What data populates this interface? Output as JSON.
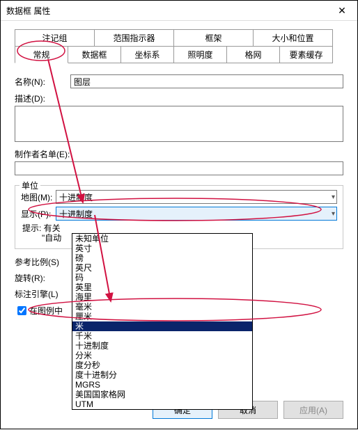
{
  "window": {
    "title": "数据框 属性"
  },
  "tabs": {
    "top": [
      {
        "label": "注记组"
      },
      {
        "label": "范围指示器"
      },
      {
        "label": "框架"
      },
      {
        "label": "大小和位置"
      }
    ],
    "bottom": [
      {
        "label": "常规"
      },
      {
        "label": "数据框"
      },
      {
        "label": "坐标系"
      },
      {
        "label": "照明度"
      },
      {
        "label": "格网"
      },
      {
        "label": "要素缓存"
      }
    ],
    "active": "常规"
  },
  "form": {
    "name_label": "名称(N):",
    "name_value": "图层",
    "desc_label": "描述(D):",
    "desc_value": "",
    "credits_label": "制作者名单(E):",
    "credits_value": ""
  },
  "units": {
    "legend": "单位",
    "map_label": "地图(M):",
    "map_value": "十进制度",
    "display_label": "显示(P):",
    "display_value": "十进制度",
    "hint_line1": "提示: 有关",
    "hint_line2": "\"自动",
    "options": [
      "未知单位",
      "英寸",
      "磅",
      "英尺",
      "码",
      "英里",
      "海里",
      "毫米",
      "厘米",
      "米",
      "千米",
      "十进制度",
      "分米",
      "度分秒",
      "度十进制分",
      "MGRS",
      "美国国家格网",
      "UTM"
    ],
    "selected_option": "米"
  },
  "lower": {
    "ref_scale_label": "参考比例(S)",
    "rotation_label": "旋转(R):",
    "label_engine_label": "标注引擎(L)",
    "legend_checkbox_label": "在图例中"
  },
  "buttons": {
    "ok": "确定",
    "cancel": "取消",
    "apply": "应用(A)"
  },
  "annotation": {
    "ellipse_color": "#d11141",
    "arrow_color": "#d11141"
  }
}
